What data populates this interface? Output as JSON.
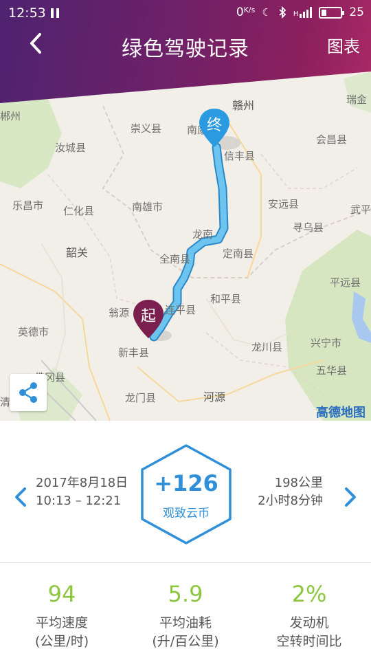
{
  "status_bar": {
    "time": "12:53",
    "speed": "0",
    "speed_unit": "K/s",
    "network": "H",
    "battery_level": "25"
  },
  "header": {
    "title": "绿色驾驶记录",
    "right_action": "图表"
  },
  "map": {
    "labels": {
      "ganzhou": "赣州",
      "ruijin": "瑞金",
      "chenzhou": "郴州",
      "chongyi": "崇义县",
      "nankang": "南康",
      "huichang": "会昌县",
      "rucheng": "汝城县",
      "xinfeng": "信丰县",
      "lechang": "乐昌市",
      "renhua": "仁化县",
      "nanxiong": "南雄市",
      "anyuan": "安远县",
      "wuping": "武平",
      "xunwu": "寻乌县",
      "shaoguan": "韶关",
      "quannan": "全南县",
      "dingnan": "定南县",
      "longnan": "龙南",
      "pingyuan": "平远县",
      "wengyuan": "翁源",
      "lianping": "连平县",
      "heping": "和平县",
      "yingde": "英德市",
      "xinfeng2": "新丰县",
      "longchuan": "龙川县",
      "xingning": "兴宁市",
      "wuhua": "五华县",
      "fogang": "佛冈县",
      "longmen": "龙门县",
      "heyuan": "河源",
      "qingyuan": "清"
    },
    "start_pin": "起",
    "end_pin": "终",
    "brand": "高德地图"
  },
  "trip": {
    "date": "2017年8月18日",
    "time_range": "10:13 – 12:21",
    "distance": "198公里",
    "duration": "2小时8分钟",
    "coins": "+126",
    "coin_label": "观致云币"
  },
  "stats": [
    {
      "value": "94",
      "label_line1": "平均速度",
      "label_line2": "(公里/时)"
    },
    {
      "value": "5.9",
      "label_line1": "平均油耗",
      "label_line2": "(升/百公里)"
    },
    {
      "value": "2%",
      "label_line1": "发动机",
      "label_line2": "空转时间比"
    }
  ],
  "colors": {
    "header_start": "#4e2270",
    "header_end": "#a92a66",
    "accent_blue": "#2f8fd8",
    "route": "#5bb8e8",
    "start_pin": "#7a1f4e",
    "end_pin": "#2a9be0",
    "stat_green": "#8cc63f"
  },
  "icons": {
    "back": "chevron-left-icon",
    "share": "share-icon",
    "prev": "chevron-left-icon",
    "next": "chevron-right-icon"
  }
}
